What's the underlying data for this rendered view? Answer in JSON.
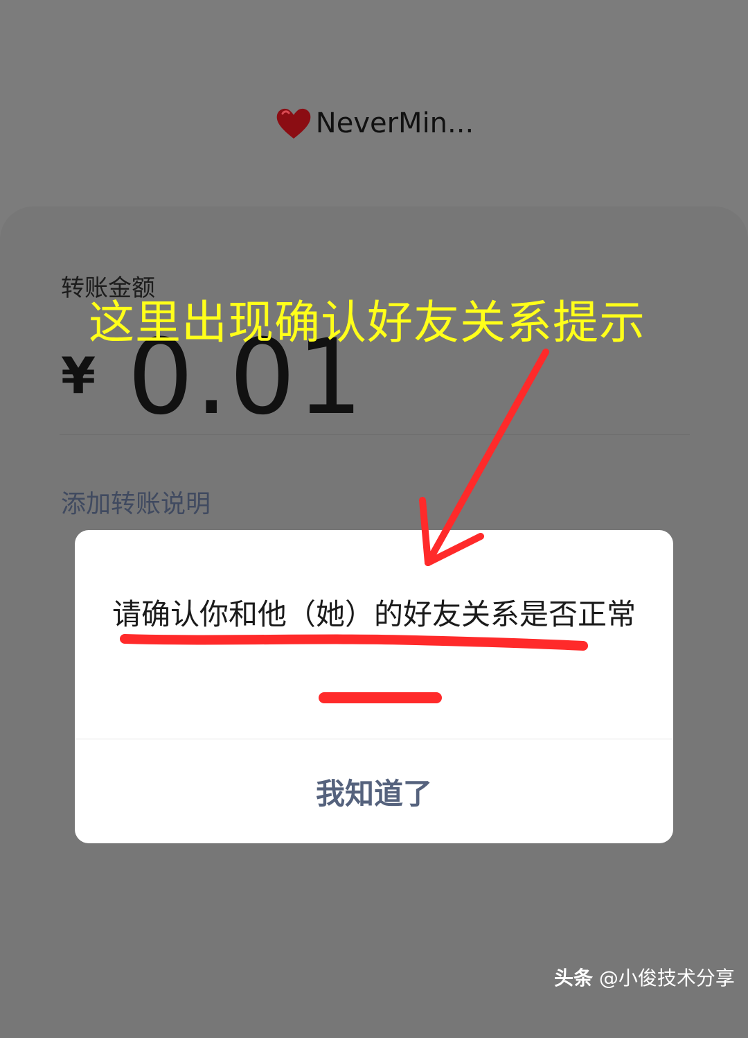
{
  "recipient": {
    "icon": "heart-icon",
    "name": "NeverMin..."
  },
  "transfer": {
    "amount_label": "转账金额",
    "currency_symbol": "¥",
    "amount": "0.01",
    "add_note_link": "添加转账说明"
  },
  "annotation": {
    "text": "这里出现确认好友关系提示",
    "color": "#ffff1a",
    "arrow_color": "#ff2a2a"
  },
  "dialog": {
    "message": "请确认你和他（她）的好友关系是否正常",
    "button_label": "我知道了",
    "button_color": "#55627d"
  },
  "watermark": {
    "brand": "头条",
    "handle": " @小俊技术分享"
  }
}
